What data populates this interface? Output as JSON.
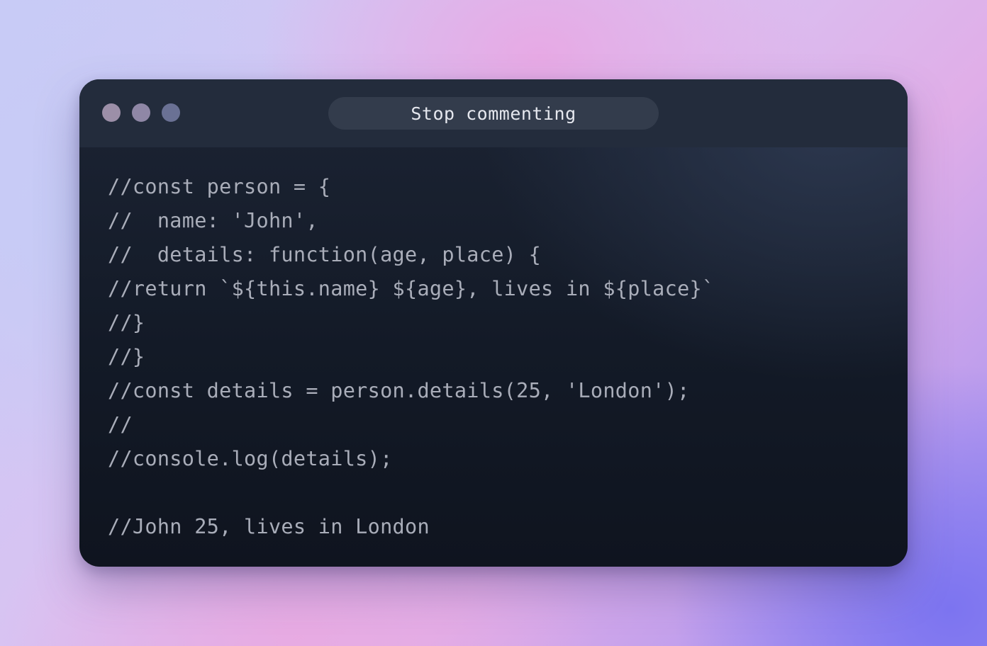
{
  "window": {
    "title": "Stop commenting",
    "controls": [
      "close-dot",
      "minimize-dot",
      "zoom-dot"
    ]
  },
  "code": {
    "lines": [
      "//const person = {",
      "//  name: 'John',",
      "//  details: function(age, place) {",
      "//return `${this.name} ${age}, lives in ${place}`",
      "//}",
      "//}",
      "//const details = person.details(25, 'London');",
      "//",
      "//console.log(details);",
      "",
      "//John 25, lives in London"
    ]
  },
  "colors": {
    "window_background": "#131a27",
    "titlebar": "#232c3c",
    "title_pill": "#333c4c",
    "code_text": "#a9adb9",
    "title_text": "#e6e8ef"
  }
}
